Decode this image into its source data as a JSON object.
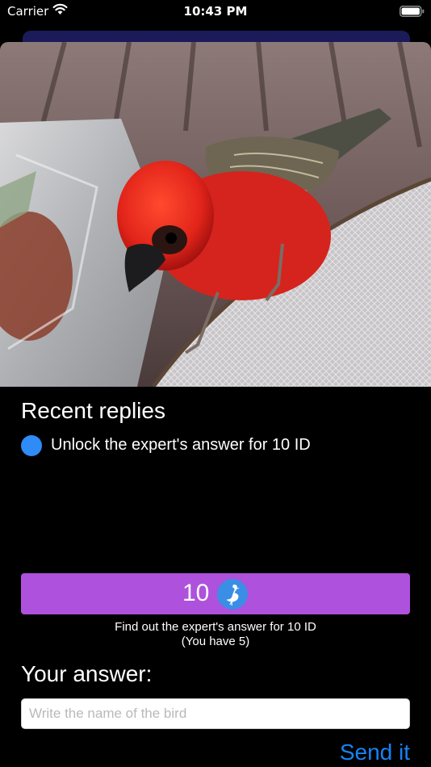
{
  "status_bar": {
    "carrier": "Carrier",
    "time": "10:43 PM",
    "icons": [
      "wifi-icon",
      "battery-icon"
    ]
  },
  "photo": {
    "subject": "bird-photo"
  },
  "replies": {
    "title": "Recent replies",
    "items": [
      {
        "text": "Unlock the expert's answer for 10 ID",
        "dot_color": "#2e8bf7"
      }
    ]
  },
  "unlock": {
    "count": "10",
    "icon": "heron-icon",
    "hint_line1": "Find out the expert's answer for 10 ID",
    "hint_line2": "(You have 5)",
    "button_color": "#ae51dc"
  },
  "answer": {
    "title": "Your answer:",
    "placeholder": "Write the name of the bird",
    "value": "",
    "send_label": "Send it",
    "send_color": "#1683f5"
  }
}
